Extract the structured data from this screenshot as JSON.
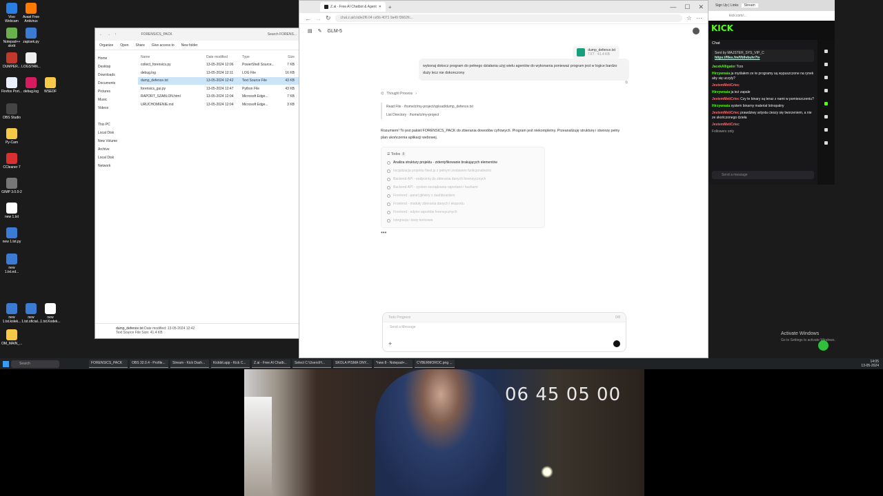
{
  "desktop": {
    "icons": [
      {
        "label": "Vivo Webcam",
        "color": "#2a7de1"
      },
      {
        "label": "Avast Free Antivirus",
        "color": "#ff7a00"
      },
      {
        "label": "Notepad++ skrót",
        "color": "#6ab04c"
      },
      {
        "label": "zapisek.py",
        "color": "#3b7bd4"
      },
      {
        "label": "DUMPER...",
        "color": "#c0392b"
      },
      {
        "label": "LOGSTAN...",
        "color": "#eeeeee"
      },
      {
        "label": "Firefox Port...",
        "color": "#e8f0ff"
      },
      {
        "label": "debug.log",
        "color": "#d81b60"
      },
      {
        "label": "WSEDF",
        "color": "#f7c948"
      },
      {
        "label": "OBS Studio",
        "color": "#444444"
      },
      {
        "label": "Py-Cam",
        "color": "#f7c948"
      },
      {
        "label": "CCleaner 7",
        "color": "#d63031"
      },
      {
        "label": "GIMP 3.0.0-2",
        "color": "#777777"
      },
      {
        "label": "new 1.txt",
        "color": "#ffffff"
      },
      {
        "label": "new 1.txt.py",
        "color": "#3b7bd4"
      },
      {
        "label": "new 1.txt.ed...",
        "color": "#3b7bd4"
      },
      {
        "label": "new 1.txt.kolek...",
        "color": "#3b7bd4"
      },
      {
        "label": "new 1.txt.oficial...",
        "color": "#3b7bd4"
      },
      {
        "label": "new 1.txt.Kodek...",
        "color": "#ffffff"
      },
      {
        "label": "OM_MAIN_...",
        "color": "#f7c948"
      }
    ]
  },
  "explorer": {
    "breadcrumb": "FORENSICS_PACK",
    "search_placeholder": "Search FORENS...",
    "toolbar": [
      "Organize",
      "Open",
      "Share",
      "Give access to",
      "New folder"
    ],
    "nav": [
      "Home",
      "Desktop",
      "Downloads",
      "Documents",
      "Pictures",
      "Music",
      "Videos",
      "This PC",
      "Local Disk",
      "New Volume",
      "Archive",
      "Local Disk",
      "Network"
    ],
    "columns": [
      "Name",
      "Date modified",
      "Type",
      "Size"
    ],
    "files": [
      {
        "name": "collect_forensics.py",
        "date": "13-05-2024 12:06",
        "type": "PowerShell Source...",
        "size": "7 KB"
      },
      {
        "name": "debug.log",
        "date": "13-05-2024 12:11",
        "type": "LOG File",
        "size": "16 KB"
      },
      {
        "name": "dump_defence.txt",
        "date": "13-05-2024 12:42",
        "type": "Text Source File",
        "size": "43 KB"
      },
      {
        "name": "forensics_gui.py",
        "date": "13-05-2024 12:47",
        "type": "Python File",
        "size": "43 KB"
      },
      {
        "name": "RAPORT_SZABLON.html",
        "date": "13-05-2024 12:04",
        "type": "Microsoft Edge...",
        "size": "7 KB"
      },
      {
        "name": "URUCHOMIENIE.md",
        "date": "13-05-2024 12:04",
        "type": "Microsoft Edge...",
        "size": "3 KB"
      }
    ],
    "detail_name": "dump_defence.txt",
    "detail_type": "Text Source File",
    "detail_modified": "Date modified: 13-05-2024 12:42",
    "detail_size": "Size: 41.4 KB"
  },
  "browser": {
    "tab_title": "Z.ai - Free AI Chatbot & Agent",
    "url": "chat.z.ai/c/a9e2f6 04 ce5b 4071 9a49 f3662fc...",
    "model": "GLM-5",
    "file_name": "dump_defence.txt",
    "file_meta": "TXT · 41.4 KB",
    "user_message": "wykonaj dokocz program do pełnego działania użyj wielu agentów do wykonania ponieważ program jest w logice bardzo duży lecz nie dokonczony",
    "thought_label": "Thought Process",
    "tool_calls": [
      "Read File  · /home/z/my-project/upload/dump_defence.txt",
      "List Directory  · /home/z/my-project"
    ],
    "assistant_message": "Rozumiem! To jest pakiet FORENSICS_PACK do zbierania dowodów cyfrowych. Program jest niekompletny. Przeanalizuję strukturę i stworzę pełny plan ukończenia aplikacji webowej.",
    "todos_label": "Todos",
    "todos_count": "8",
    "todos": [
      {
        "text": "Analiza struktury projektu - zidentyfikowanie brakujących elementów",
        "state": "active"
      },
      {
        "text": "Inicjalizacja projektu Next.js z pełnym zestawem funkcjonalności",
        "state": "pending"
      },
      {
        "text": "Backend API - endpointy do zbierania danych forensycznych",
        "state": "pending"
      },
      {
        "text": "Backend API - system zarządzania raportami i hashami",
        "state": "pending"
      },
      {
        "text": "Frontend - panel główny z dashboardem",
        "state": "pending"
      },
      {
        "text": "Frontend - moduły zbierania danych i eksportu",
        "state": "pending"
      },
      {
        "text": "Frontend - edytor raportów forensycznych",
        "state": "pending"
      },
      {
        "text": "Integracja i testy końcowe",
        "state": "pending"
      }
    ],
    "loading": "•••",
    "compose_top_left": "Todo Progress",
    "compose_top_right": "0/8",
    "compose_placeholder": "Send a Message",
    "compose_plus": "+"
  },
  "kick": {
    "tab1": "Sign Up | Links",
    "tab2": "Stream",
    "logo": "KICK",
    "chat_title": "Chat",
    "pinned_by": "Sent by  MAJSTER_SYS_VIP_C",
    "pinned_link": "https://files.fm/f/b9vbuhr7tv",
    "messages": [
      {
        "user": "JacekAlligator",
        "text": "Trzo",
        "hl": false
      },
      {
        "user": "Hirzywnaia",
        "text": "ja myślałem ze te programy są wypuszczone na rynek aby się uczyły?",
        "hl": false
      },
      {
        "user": "JestemMetiCriec",
        "text": "",
        "hl": true
      },
      {
        "user": "Hirzywnaia",
        "text": "ja też zapale",
        "hl": false
      },
      {
        "user": "JestemMetiCriec",
        "text": "Czy te binary są teraz z nami w pomieszczeniu?",
        "hl": true
      },
      {
        "user": "Hirzywnaia",
        "text": "system binarny materiał lotnopalny",
        "hl": false
      },
      {
        "user": "JestemMetiCriec",
        "text": "prawdziwy artysta cieszy się tworzeniem, a nie ze skończonego dzieła",
        "hl": true
      },
      {
        "user": "JestemMetiCriec",
        "text": "",
        "hl": true
      }
    ],
    "followers_only": "Followers only",
    "send_placeholder": "Send a message"
  },
  "activation": {
    "title": "Activate Windows",
    "subtitle": "Go to Settings to activate Windows."
  },
  "taskbar": {
    "search": "Search",
    "items": [
      "FORENSICS_PACK",
      "OBS 32.0.4 - Profile...",
      "Stream - Kick Dash...",
      "Kickbit.app - Kick C...",
      "Z.ai - Free AI Chatb...",
      "Select C:\\Users\\H...",
      "SKOLA PISMA ONY...",
      "*new 8 - Notepad+...",
      "CYBERMOROC.png ..."
    ],
    "time": "14:05",
    "date": "13-05-2024"
  },
  "webcam": {
    "timestamp": "06 45 05 00"
  }
}
